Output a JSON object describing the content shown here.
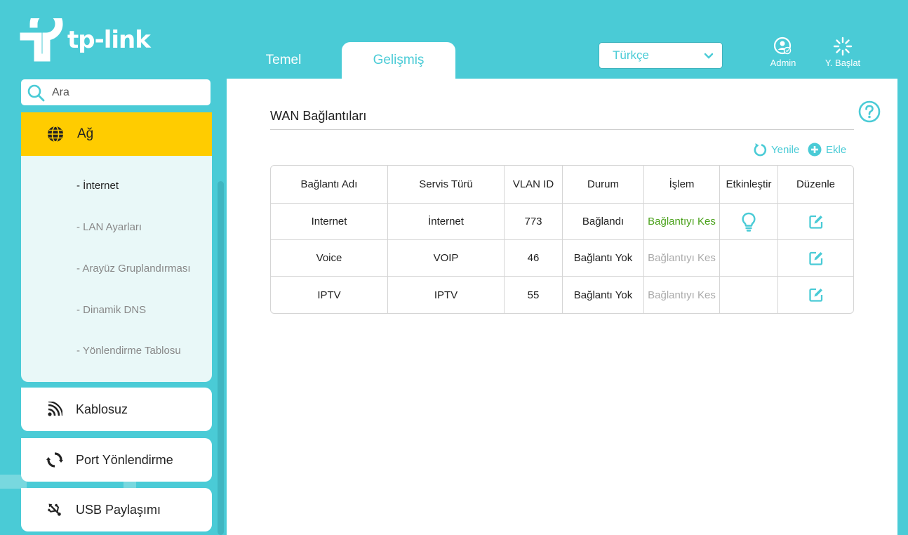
{
  "header": {
    "logo_text": "tp-link",
    "tabs": [
      {
        "label": "Temel",
        "active": false
      },
      {
        "label": "Gelişmiş",
        "active": true
      }
    ],
    "language": {
      "selected": "Türkçe"
    },
    "admin_label": "Admin",
    "reboot_label": "Y. Başlat"
  },
  "sidebar": {
    "search_placeholder": "Ara",
    "active_menu": {
      "label": "Ağ",
      "icon": "globe-icon"
    },
    "submenu": [
      {
        "label": "- İnternet",
        "active": true
      },
      {
        "label": "- LAN Ayarları",
        "active": false
      },
      {
        "label": "- Arayüz Gruplandırması",
        "active": false
      },
      {
        "label": "- Dinamik DNS",
        "active": false
      },
      {
        "label": "- Yönlendirme Tablosu",
        "active": false
      }
    ],
    "menu": [
      {
        "label": "Kablosuz",
        "icon": "wifi-icon"
      },
      {
        "label": "Port Yönlendirme",
        "icon": "port-forward-icon"
      },
      {
        "label": "USB Paylaşımı",
        "icon": "usb-icon"
      }
    ]
  },
  "main": {
    "title": "WAN Bağlantıları",
    "actions": {
      "refresh": "Yenile",
      "add": "Ekle"
    },
    "table": {
      "columns": [
        "Bağlantı Adı",
        "Servis Türü",
        "VLAN ID",
        "Durum",
        "İşlem",
        "Etkinleştir",
        "Düzenle"
      ],
      "rows": [
        {
          "name": "Internet",
          "service": "İnternet",
          "vlan": "773",
          "status": "Bağlandı",
          "operation": "Bağlantıyı Kes",
          "operation_enabled": true,
          "enable_icon": "bulb-icon"
        },
        {
          "name": "Voice",
          "service": "VOIP",
          "vlan": "46",
          "status": "Bağlantı Yok",
          "operation": "Bağlantıyı Kes",
          "operation_enabled": false,
          "enable_icon": ""
        },
        {
          "name": "IPTV",
          "service": "IPTV",
          "vlan": "55",
          "status": "Bağlantı Yok",
          "operation": "Bağlantıyı Kes",
          "operation_enabled": false,
          "enable_icon": ""
        }
      ]
    }
  },
  "colors": {
    "accent": "#4acbd6",
    "active_menu": "#ffcc00",
    "connected": "#4aa11b",
    "disabled": "#aaaaaa"
  }
}
